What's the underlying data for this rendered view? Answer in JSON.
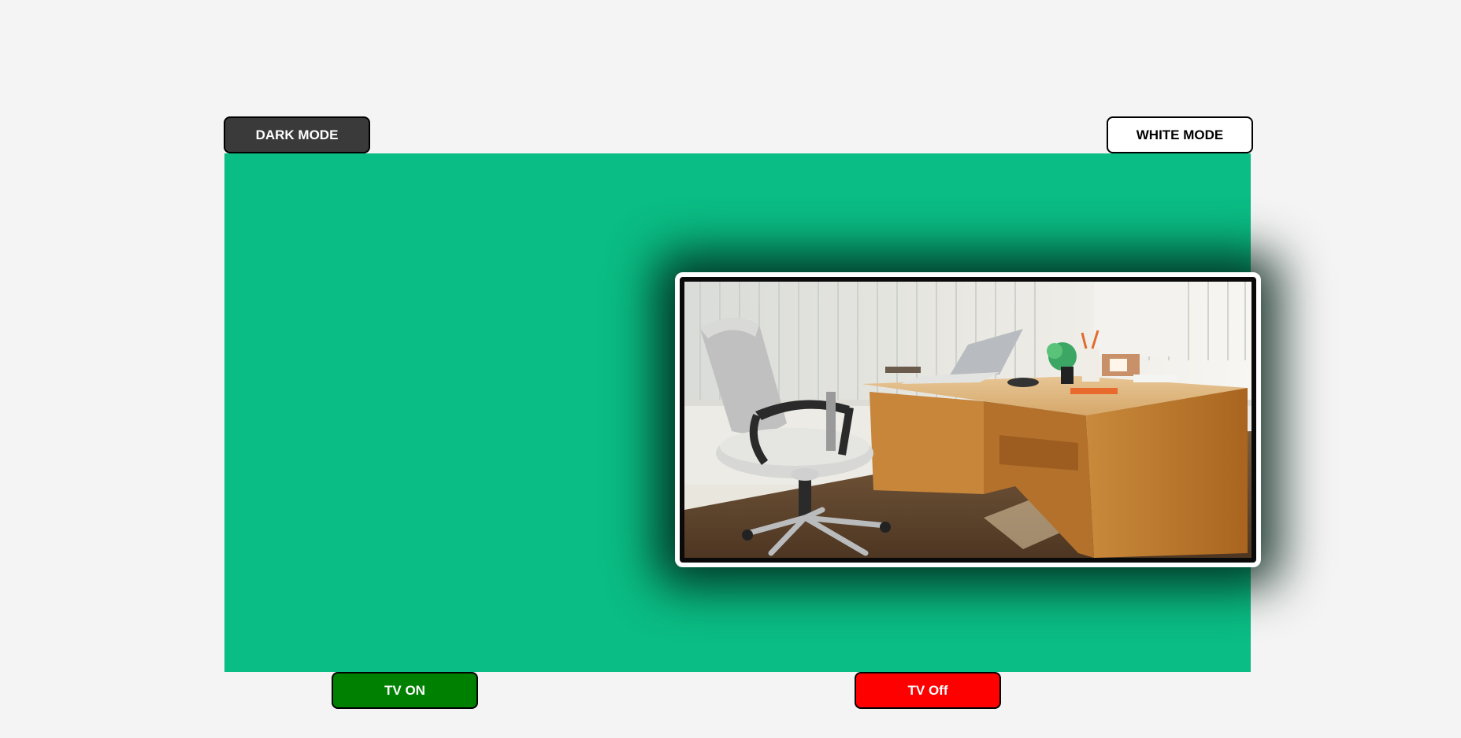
{
  "controls": {
    "dark_mode_label": "DARK MODE",
    "white_mode_label": "WHITE MODE",
    "tv_on_label": "TV ON",
    "tv_off_label": "TV Off"
  },
  "colors": {
    "stage_background": "#0abd84",
    "tv_on": "#008000",
    "tv_off": "#ff0000",
    "dark_mode": "#3a3a3a",
    "page_background": "#f4f4f4"
  },
  "tv_screen": {
    "image_content": "office-desk-with-chair-photo"
  }
}
